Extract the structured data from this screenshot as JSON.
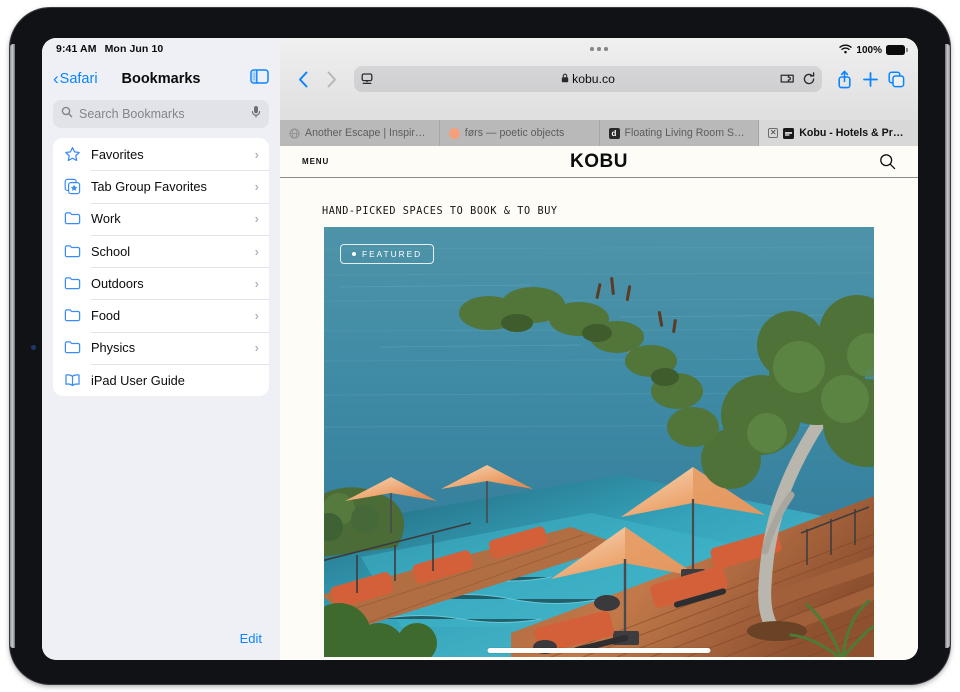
{
  "status": {
    "time": "9:41 AM",
    "date": "Mon Jun 10",
    "battery_percent": "100%",
    "wifi_icon": "wifi-icon",
    "battery_icon": "battery-full-icon"
  },
  "sidebar": {
    "back_label": "Safari",
    "title": "Bookmarks",
    "toggle_icon": "sidebar-toggle-icon",
    "search": {
      "placeholder": "Search Bookmarks",
      "value": "",
      "search_icon": "search-icon",
      "mic_icon": "microphone-icon"
    },
    "items": [
      {
        "label": "Favorites",
        "icon": "star-icon",
        "chevron": "›"
      },
      {
        "label": "Tab Group Favorites",
        "icon": "tab-group-icon",
        "chevron": "›"
      },
      {
        "label": "Work",
        "icon": "folder-icon",
        "chevron": "›"
      },
      {
        "label": "School",
        "icon": "folder-icon",
        "chevron": "›"
      },
      {
        "label": "Outdoors",
        "icon": "folder-icon",
        "chevron": "›"
      },
      {
        "label": "Food",
        "icon": "folder-icon",
        "chevron": "›"
      },
      {
        "label": "Physics",
        "icon": "folder-icon",
        "chevron": "›"
      },
      {
        "label": "iPad User Guide",
        "icon": "book-icon",
        "chevron": ""
      }
    ],
    "edit_label": "Edit"
  },
  "browser": {
    "back_icon": "chevron-left-icon",
    "forward_icon": "chevron-right-icon",
    "address": {
      "url": "kobu.co",
      "lock_icon": "lock-icon",
      "reader_icon": "page-settings-icon",
      "extensions_icon": "extensions-puzzle-icon",
      "reload_icon": "reload-icon"
    },
    "share_icon": "share-icon",
    "new_tab_icon": "plus-icon",
    "tabs_overview_icon": "tabs-overview-icon",
    "tabs": [
      {
        "title": "Another Escape | Inspir…",
        "favicon": "globe-icon",
        "favicon_color": "#d9d9db",
        "active": false,
        "closable": false
      },
      {
        "title": "førs — poetic objects",
        "favicon": "circle-icon",
        "favicon_color": "#f4a07c",
        "active": false,
        "closable": false
      },
      {
        "title": "Floating Living Room Se…",
        "favicon": "letter-d-icon",
        "favicon_color": "#2a2a2d",
        "active": false,
        "closable": false
      },
      {
        "title": "Kobu - Hotels & Propert…",
        "favicon": "kobu-icon",
        "favicon_color": "#1a1a1c",
        "active": true,
        "closable": true,
        "close_icon": "close-icon"
      }
    ]
  },
  "site": {
    "menu_label": "MENU",
    "logo": "KOBU",
    "search_icon": "search-icon",
    "tagline": "HAND-PICKED SPACES TO BOOK & TO BUY",
    "hero": {
      "badge_label": "FEATURED",
      "badge_dot": "dot-icon",
      "alt": "Cliffside resort infinity pool with orange umbrellas and loungers overlooking the ocean"
    }
  },
  "home_indicator": "home-indicator",
  "colors": {
    "accent_blue": "#0a84ff",
    "sidebar_bg": "#eef0f6",
    "page_bg": "#fdfcf7",
    "umbrella_orange": "#e8955f",
    "ocean_blue": "#3f8ba5"
  }
}
